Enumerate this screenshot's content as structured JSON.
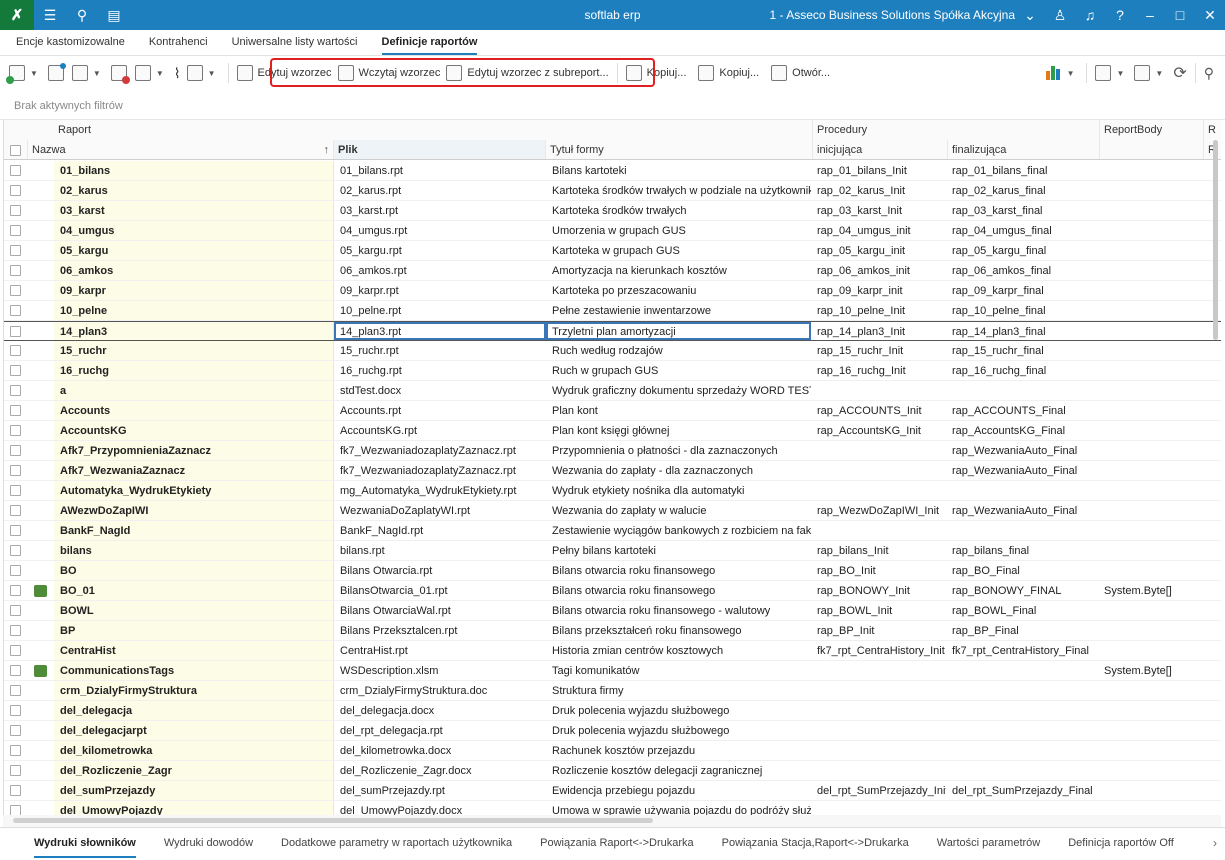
{
  "app": {
    "title": "softlab erp",
    "company": "1 - Asseco Business Solutions Spółka Akcyjna",
    "logo_icon": "tools-icon",
    "accent": "#1e7fbf"
  },
  "top_tabs": [
    {
      "label": "Encje kastomizowalne",
      "active": false
    },
    {
      "label": "Kontrahenci",
      "active": false
    },
    {
      "label": "Uniwersalne listy wartości",
      "active": false
    },
    {
      "label": "Definicje raportów",
      "active": true
    }
  ],
  "toolbar": {
    "edytuj_wzorzec": "Edytuj wzorzec",
    "wczytaj_wzorzec": "Wczytaj wzorzec",
    "edytuj_subreport": "Edytuj wzorzec z subreport...",
    "kopiuj1": "Kopiuj...",
    "kopiuj2": "Kopiuj...",
    "otworz": "Otwór..."
  },
  "filter": {
    "text": "Brak aktywnych filtrów"
  },
  "grid": {
    "group_headers": {
      "raport": "Raport",
      "procedury": "Procedury",
      "reportbody": "ReportBody",
      "cut": "R"
    },
    "columns": {
      "nazwa": "Nazwa",
      "plik": "Plik",
      "tytul": "Tytuł formy",
      "inicjujaca": "inicjująca",
      "finalizujaca": "finalizująca",
      "cut": "R"
    },
    "rows": [
      {
        "mark": false,
        "nazwa": "01_bilans",
        "plik": "01_bilans.rpt",
        "tytul": "Bilans kartoteki",
        "init": "rap_01_bilans_Init",
        "final": "rap_01_bilans_final",
        "body": ""
      },
      {
        "mark": false,
        "nazwa": "02_karus",
        "plik": "02_karus.rpt",
        "tytul": "Kartoteka środków trwałych w podziale na użytkowników",
        "init": "rap_02_karus_Init",
        "final": "rap_02_karus_final",
        "body": ""
      },
      {
        "mark": false,
        "nazwa": "03_karst",
        "plik": "03_karst.rpt",
        "tytul": "Kartoteka środków trwałych",
        "init": "rap_03_karst_Init",
        "final": "rap_03_karst_final",
        "body": ""
      },
      {
        "mark": false,
        "nazwa": "04_umgus",
        "plik": "04_umgus.rpt",
        "tytul": "Umorzenia w grupach GUS",
        "init": "rap_04_umgus_init",
        "final": "rap_04_umgus_final",
        "body": ""
      },
      {
        "mark": false,
        "nazwa": "05_kargu",
        "plik": "05_kargu.rpt",
        "tytul": "Kartoteka w grupach GUS",
        "init": "rap_05_kargu_init",
        "final": "rap_05_kargu_final",
        "body": ""
      },
      {
        "mark": false,
        "nazwa": "06_amkos",
        "plik": "06_amkos.rpt",
        "tytul": "Amortyzacja na kierunkach kosztów",
        "init": "rap_06_amkos_init",
        "final": "rap_06_amkos_final",
        "body": ""
      },
      {
        "mark": false,
        "nazwa": "09_karpr",
        "plik": "09_karpr.rpt",
        "tytul": "Kartoteka po przeszacowaniu",
        "init": "rap_09_karpr_init",
        "final": "rap_09_karpr_final",
        "body": ""
      },
      {
        "mark": false,
        "nazwa": "10_pelne",
        "plik": "10_pelne.rpt",
        "tytul": "Pełne zestawienie inwentarzowe",
        "init": "rap_10_pelne_Init",
        "final": "rap_10_pelne_final",
        "body": ""
      },
      {
        "mark": false,
        "nazwa": "14_plan3",
        "plik": "14_plan3.rpt",
        "tytul": "Trzyletni plan amortyzacji",
        "init": "rap_14_plan3_Init",
        "final": "rap_14_plan3_final",
        "body": "",
        "selected": true
      },
      {
        "mark": false,
        "nazwa": "15_ruchr",
        "plik": "15_ruchr.rpt",
        "tytul": "Ruch według rodzajów",
        "init": "rap_15_ruchr_Init",
        "final": "rap_15_ruchr_final",
        "body": ""
      },
      {
        "mark": false,
        "nazwa": "16_ruchg",
        "plik": "16_ruchg.rpt",
        "tytul": "Ruch w grupach GUS",
        "init": "rap_16_ruchg_Init",
        "final": "rap_16_ruchg_final",
        "body": ""
      },
      {
        "mark": false,
        "nazwa": "a",
        "plik": "stdTest.docx",
        "tytul": "Wydruk graficzny dokumentu sprzedaży WORD TEST",
        "init": "",
        "final": "",
        "body": ""
      },
      {
        "mark": false,
        "nazwa": "Accounts",
        "plik": "Accounts.rpt",
        "tytul": "Plan kont",
        "init": "rap_ACCOUNTS_Init",
        "final": "rap_ACCOUNTS_Final",
        "body": ""
      },
      {
        "mark": false,
        "nazwa": "AccountsKG",
        "plik": "AccountsKG.rpt",
        "tytul": "Plan kont księgi głównej",
        "init": "rap_AccountsKG_Init",
        "final": "rap_AccountsKG_Final",
        "body": ""
      },
      {
        "mark": false,
        "nazwa": "Afk7_PrzypomnieniaZaznacz",
        "plik": "fk7_WezwaniadozaplatyZaznacz.rpt",
        "tytul": "Przypomnienia o płatności  -  dla zaznaczonych",
        "init": "",
        "final": "rap_WezwaniaAuto_Final",
        "body": ""
      },
      {
        "mark": false,
        "nazwa": "Afk7_WezwaniaZaznacz",
        "plik": "fk7_WezwaniadozaplatyZaznacz.rpt",
        "tytul": "Wezwania do zapłaty  -  dla zaznaczonych",
        "init": "",
        "final": "rap_WezwaniaAuto_Final",
        "body": ""
      },
      {
        "mark": false,
        "nazwa": "Automatyka_WydrukEtykiety",
        "plik": "mg_Automatyka_WydrukEtykiety.rpt",
        "tytul": "Wydruk etykiety nośnika dla automatyki",
        "init": "",
        "final": "",
        "body": ""
      },
      {
        "mark": false,
        "nazwa": "AWezwDoZapIWI",
        "plik": "WezwaniaDoZaplatyWI.rpt",
        "tytul": "Wezwania do zapłaty w walucie",
        "init": "rap_WezwDoZapIWI_Init",
        "final": "rap_WezwaniaAuto_Final",
        "body": ""
      },
      {
        "mark": false,
        "nazwa": "BankF_NagId",
        "plik": "BankF_NagId.rpt",
        "tytul": "Zestawienie wyciągów bankowych z rozbiciem na faktury",
        "init": "",
        "final": "",
        "body": ""
      },
      {
        "mark": false,
        "nazwa": "bilans",
        "plik": "bilans.rpt",
        "tytul": "Pełny bilans kartoteki",
        "init": "rap_bilans_Init",
        "final": "rap_bilans_final",
        "body": ""
      },
      {
        "mark": false,
        "nazwa": "BO",
        "plik": "Bilans Otwarcia.rpt",
        "tytul": "Bilans otwarcia roku finansowego",
        "init": "rap_BO_Init",
        "final": "rap_BO_Final",
        "body": ""
      },
      {
        "mark": true,
        "nazwa": "BO_01",
        "plik": "BilansOtwarcia_01.rpt",
        "tytul": "Bilans otwarcia roku finansowego",
        "init": "rap_BONOWY_Init",
        "final": "rap_BONOWY_FINAL",
        "body": "System.Byte[]"
      },
      {
        "mark": false,
        "nazwa": "BOWL",
        "plik": "Bilans OtwarciaWal.rpt",
        "tytul": "Bilans otwarcia roku finansowego - walutowy",
        "init": "rap_BOWL_Init",
        "final": "rap_BOWL_Final",
        "body": ""
      },
      {
        "mark": false,
        "nazwa": "BP",
        "plik": "Bilans Przeksztalcen.rpt",
        "tytul": "Bilans przekształceń roku finansowego",
        "init": "rap_BP_Init",
        "final": "rap_BP_Final",
        "body": ""
      },
      {
        "mark": false,
        "nazwa": "CentraHist",
        "plik": "CentraHist.rpt",
        "tytul": "Historia zmian centrów kosztowych",
        "init": "fk7_rpt_CentraHistory_Init",
        "final": "fk7_rpt_CentraHistory_Final",
        "body": ""
      },
      {
        "mark": true,
        "nazwa": "CommunicationsTags",
        "plik": "WSDescription.xlsm",
        "tytul": "Tagi komunikatów",
        "init": "",
        "final": "",
        "body": "System.Byte[]"
      },
      {
        "mark": false,
        "nazwa": "crm_DzialyFirmyStruktura",
        "plik": "crm_DzialyFirmyStruktura.doc",
        "tytul": "Struktura firmy",
        "init": "",
        "final": "",
        "body": ""
      },
      {
        "mark": false,
        "nazwa": "del_delegacja",
        "plik": "del_delegacja.docx",
        "tytul": "Druk polecenia wyjazdu służbowego",
        "init": "",
        "final": "",
        "body": ""
      },
      {
        "mark": false,
        "nazwa": "del_delegacjarpt",
        "plik": "del_rpt_delegacja.rpt",
        "tytul": "Druk polecenia wyjazdu służbowego",
        "init": "",
        "final": "",
        "body": ""
      },
      {
        "mark": false,
        "nazwa": "del_kilometrowka",
        "plik": "del_kilometrowka.docx",
        "tytul": "Rachunek kosztów przejazdu",
        "init": "",
        "final": "",
        "body": ""
      },
      {
        "mark": false,
        "nazwa": "del_Rozliczenie_Zagr",
        "plik": "del_Rozliczenie_Zagr.docx",
        "tytul": "Rozliczenie kosztów delegacji zagranicznej",
        "init": "",
        "final": "",
        "body": ""
      },
      {
        "mark": false,
        "nazwa": "del_sumPrzejazdy",
        "plik": "del_sumPrzejazdy.rpt",
        "tytul": "Ewidencja przebiegu pojazdu",
        "init": "del_rpt_SumPrzejazdy_Init",
        "final": "del_rpt_SumPrzejazdy_Final",
        "body": ""
      },
      {
        "mark": false,
        "nazwa": "del_UmowyPojazdy",
        "plik": "del_UmowyPojazdy.docx",
        "tytul": "Umowa w sprawie używania pojazdu do podróży służbowych",
        "init": "",
        "final": "",
        "body": ""
      }
    ]
  },
  "bottom_tabs": [
    {
      "label": "Wydruki słowników",
      "active": true
    },
    {
      "label": "Wydruki dowodów",
      "active": false
    },
    {
      "label": "Dodatkowe parametry w raportach użytkownika",
      "active": false
    },
    {
      "label": "Powiązania Raport<->Drukarka",
      "active": false
    },
    {
      "label": "Powiązania Stacja,Raport<->Drukarka",
      "active": false
    },
    {
      "label": "Wartości parametrów",
      "active": false
    },
    {
      "label": "Definicja raportów Off",
      "active": false
    }
  ]
}
